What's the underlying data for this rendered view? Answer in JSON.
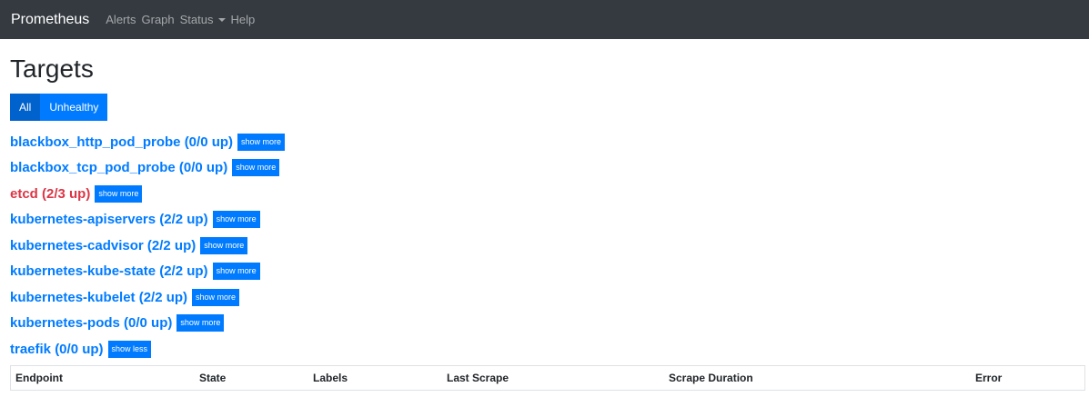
{
  "navbar": {
    "brand": "Prometheus",
    "links": [
      "Alerts",
      "Graph",
      "Status",
      "Help"
    ]
  },
  "page": {
    "title": "Targets"
  },
  "filters": {
    "all": "All",
    "unhealthy": "Unhealthy",
    "active": "All"
  },
  "targets": [
    {
      "name": "blackbox_http_pod_probe (0/0 up)",
      "button": "show more",
      "status": "ok"
    },
    {
      "name": "blackbox_tcp_pod_probe (0/0 up)",
      "button": "show more",
      "status": "ok"
    },
    {
      "name": "etcd (2/3 up)",
      "button": "show more",
      "status": "danger"
    },
    {
      "name": "kubernetes-apiservers (2/2 up)",
      "button": "show more",
      "status": "ok"
    },
    {
      "name": "kubernetes-cadvisor (2/2 up)",
      "button": "show more",
      "status": "ok"
    },
    {
      "name": "kubernetes-kube-state (2/2 up)",
      "button": "show more",
      "status": "ok"
    },
    {
      "name": "kubernetes-kubelet (2/2 up)",
      "button": "show more",
      "status": "ok"
    },
    {
      "name": "kubernetes-pods (0/0 up)",
      "button": "show more",
      "status": "ok"
    },
    {
      "name": "traefik (0/0 up)",
      "button": "show less",
      "status": "ok"
    }
  ],
  "table": {
    "headers": [
      "Endpoint",
      "State",
      "Labels",
      "Last Scrape",
      "Scrape Duration",
      "Error"
    ]
  },
  "colors": {
    "navbar": "#343a40",
    "primary": "#007bff",
    "danger": "#dc3545"
  }
}
